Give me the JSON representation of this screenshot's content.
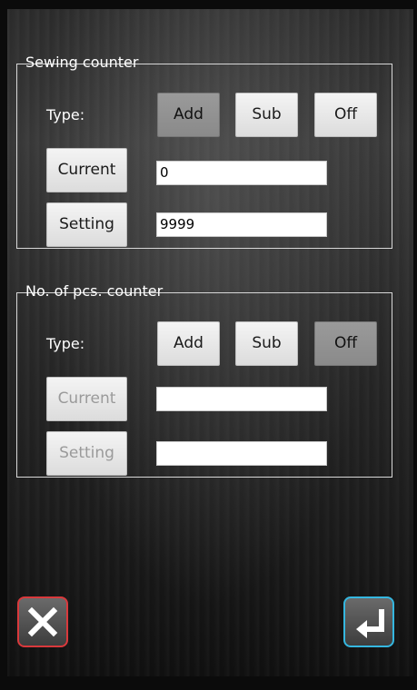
{
  "sewing_counter": {
    "title": "Sewing counter",
    "type_label": "Type:",
    "buttons": {
      "add": "Add",
      "sub": "Sub",
      "off": "Off"
    },
    "selected": "Add",
    "current_label": "Current",
    "current_value": "0",
    "setting_label": "Setting",
    "setting_value": "9999"
  },
  "pcs_counter": {
    "title": "No. of pcs. counter",
    "type_label": "Type:",
    "buttons": {
      "add": "Add",
      "sub": "Sub",
      "off": "Off"
    },
    "selected": "Off",
    "current_label": "Current",
    "current_value": "",
    "setting_label": "Setting",
    "setting_value": ""
  },
  "footer": {
    "cancel_icon": "close-icon",
    "confirm_icon": "enter-return-icon",
    "cancel_color": "#d9393c",
    "confirm_color": "#35b7e0"
  }
}
